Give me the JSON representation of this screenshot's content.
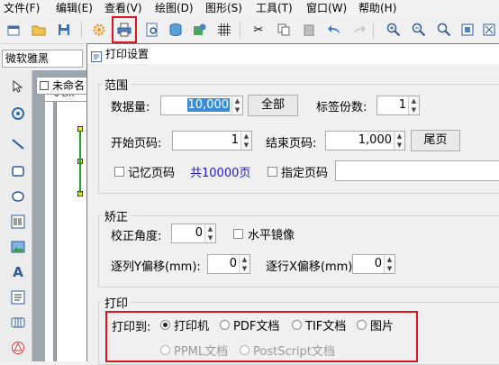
{
  "menu": [
    "文件(F)",
    "编辑(E)",
    "查看(V)",
    "绘图(D)",
    "图形(S)",
    "工具(T)",
    "窗口(W)",
    "帮助(H)"
  ],
  "font": {
    "name": "微软雅黑"
  },
  "document": {
    "tab_label": "未命名",
    "ruler_unit": "0 cm"
  },
  "dialog": {
    "title": "打印设置",
    "range": {
      "group_label": "范围",
      "data_count_label": "数据量:",
      "data_count_value": "10,000",
      "all_button": "全部",
      "label_copies_label": "标签份数:",
      "label_copies_value": "1",
      "start_page_label": "开始页码:",
      "start_page_value": "1",
      "end_page_label": "结束页码:",
      "end_page_value": "1,000",
      "last_page_button": "尾页",
      "remember_page_label": "记忆页码",
      "total_pages": "共10000页",
      "specify_page_label": "指定页码"
    },
    "correction": {
      "group_label": "矫正",
      "angle_label": "校正角度:",
      "angle_value": "0",
      "mirror_label": "水平镜像",
      "y_offset_label": "逐列Y偏移(mm):",
      "y_offset_value": "0",
      "x_offset_label": "逐行X偏移(mm):",
      "x_offset_value": "0"
    },
    "print": {
      "group_label": "打印",
      "print_to_label": "打印到:",
      "options": [
        "打印机",
        "PDF文档",
        "TIF文档",
        "图片"
      ],
      "disabled_options": [
        "PPML文档",
        "PostScript文档"
      ]
    }
  },
  "colors": {
    "highlight": "#e0151b",
    "total_pages_text": "#1a1ad6"
  }
}
